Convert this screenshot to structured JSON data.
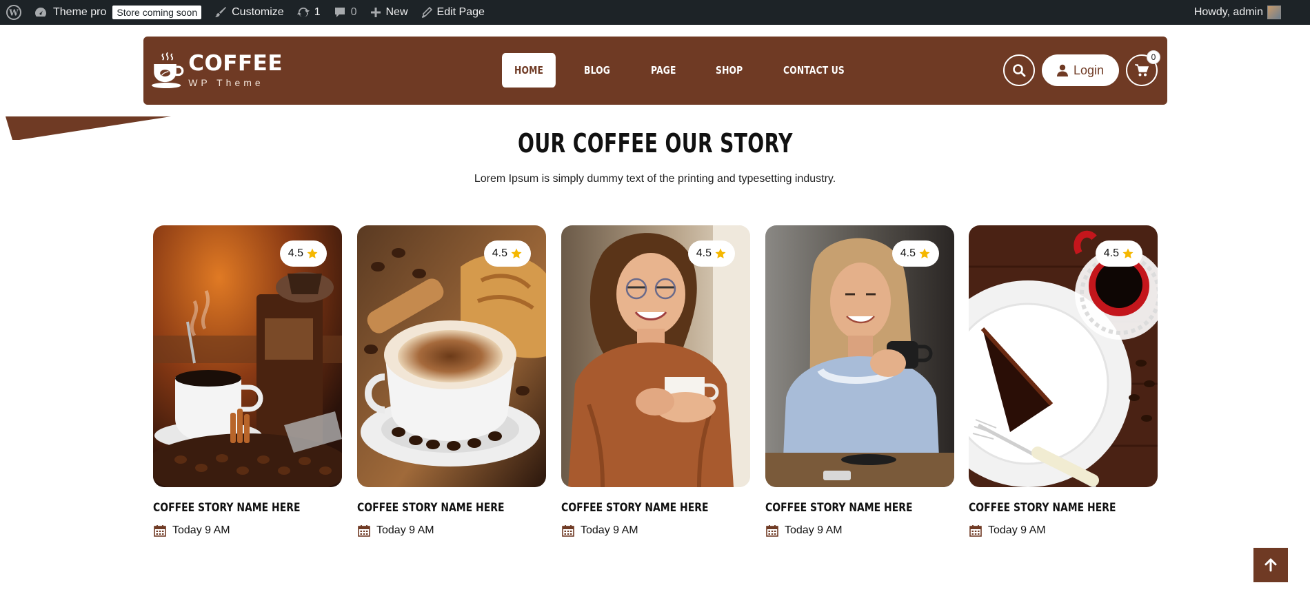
{
  "admin_bar": {
    "site_name": "Theme pro",
    "store_badge": "Store coming soon",
    "customize": "Customize",
    "updates_count": "1",
    "comments_count": "0",
    "new_label": "New",
    "edit_page": "Edit Page",
    "greeting": "Howdy, admin"
  },
  "header": {
    "logo_title": "COFFEE",
    "logo_subtitle": "WP Theme",
    "nav": [
      {
        "label": "HOME",
        "active": true
      },
      {
        "label": "BLOG",
        "active": false
      },
      {
        "label": "PAGE",
        "active": false
      },
      {
        "label": "SHOP",
        "active": false
      },
      {
        "label": "CONTACT US",
        "active": false
      }
    ],
    "login_label": "Login",
    "cart_count": "0"
  },
  "section": {
    "title": "OUR COFFEE OUR STORY",
    "subtitle": "Lorem Ipsum is simply dummy text of the printing and typesetting industry."
  },
  "cards": [
    {
      "rating": "4.5",
      "title": "COFFEE STORY NAME HERE",
      "date": "Today 9 AM",
      "image": "coffee-grinder-and-cup"
    },
    {
      "rating": "4.5",
      "title": "COFFEE STORY NAME HERE",
      "date": "Today 9 AM",
      "image": "cappuccino-and-croissant"
    },
    {
      "rating": "4.5",
      "title": "COFFEE STORY NAME HERE",
      "date": "Today 9 AM",
      "image": "smiling-woman-with-cup"
    },
    {
      "rating": "4.5",
      "title": "COFFEE STORY NAME HERE",
      "date": "Today 9 AM",
      "image": "woman-drinking-coffee"
    },
    {
      "rating": "4.5",
      "title": "COFFEE STORY NAME HERE",
      "date": "Today 9 AM",
      "image": "chocolate-cake-and-espresso"
    }
  ],
  "colors": {
    "brand": "#6f3a24",
    "admin_bar": "#1d2327",
    "star": "#f5b700"
  }
}
